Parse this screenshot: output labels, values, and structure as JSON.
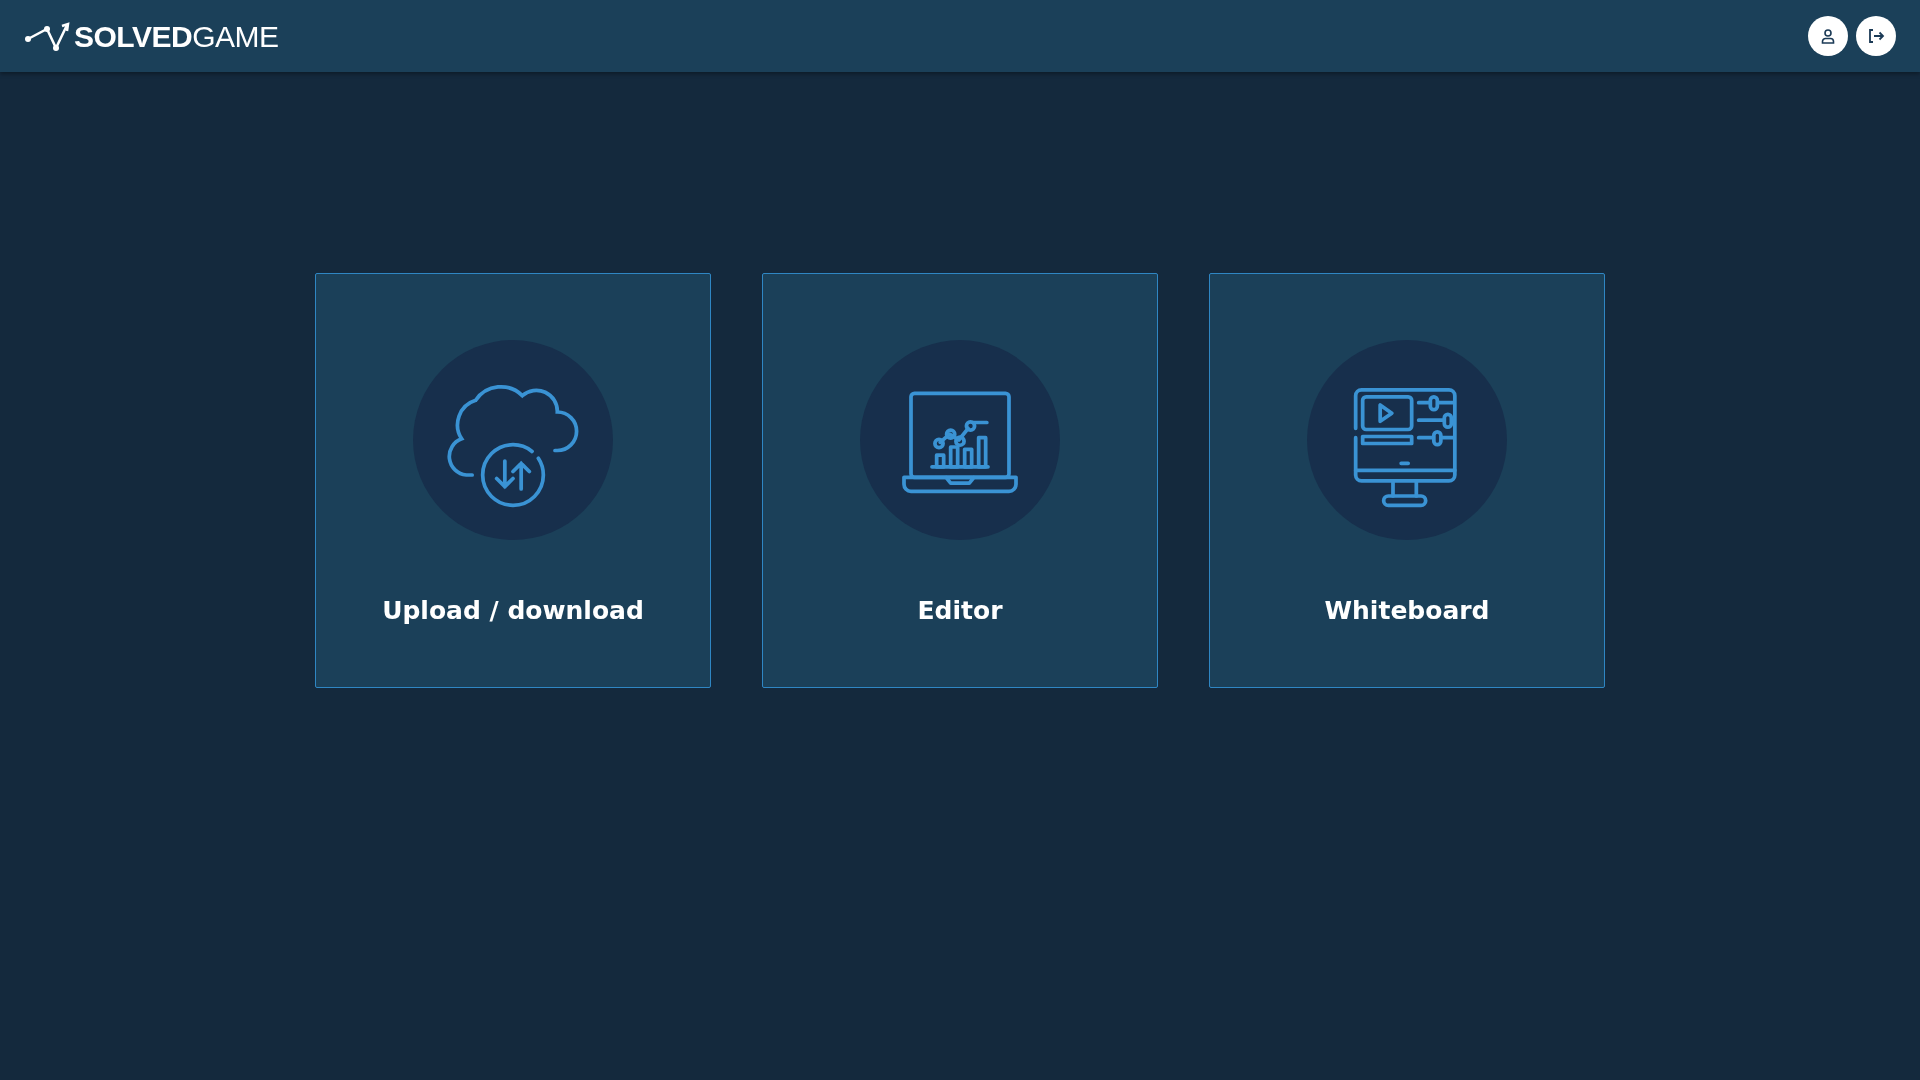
{
  "navbar": {
    "logo": "**SOLVED**GAME"
  },
  "cards": [
    {
      "kind": "cloud",
      "title": "Upload / download"
    },
    {
      "kind": "laptop",
      "title": "Editor"
    },
    {
      "kind": "monitor",
      "title": "Whiteboard"
    }
  ]
}
